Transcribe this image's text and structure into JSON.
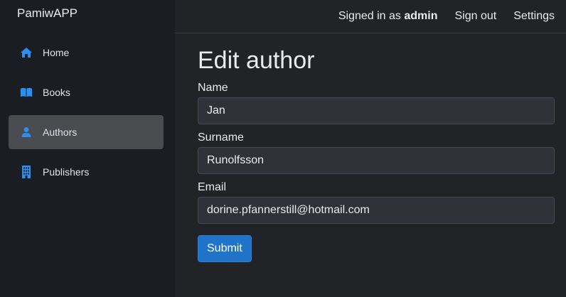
{
  "app": {
    "brand": "PamiwAPP"
  },
  "colors": {
    "accent": "#1f74c9",
    "icon": "#2b8ef0",
    "active_bg": "#4a4c50"
  },
  "sidebar": {
    "items": [
      {
        "label": "Home",
        "icon": "home-icon"
      },
      {
        "label": "Books",
        "icon": "book-icon"
      },
      {
        "label": "Authors",
        "icon": "person-icon",
        "active": true
      },
      {
        "label": "Publishers",
        "icon": "building-icon"
      }
    ]
  },
  "topbar": {
    "signed_prefix": "Signed in as ",
    "user": "admin",
    "sign_out": "Sign out",
    "settings": "Settings"
  },
  "form": {
    "title": "Edit author",
    "fields": [
      {
        "label": "Name",
        "value": "Jan"
      },
      {
        "label": "Surname",
        "value": "Runolfsson"
      },
      {
        "label": "Email",
        "value": "dorine.pfannerstill@hotmail.com"
      }
    ],
    "submit": "Submit"
  }
}
